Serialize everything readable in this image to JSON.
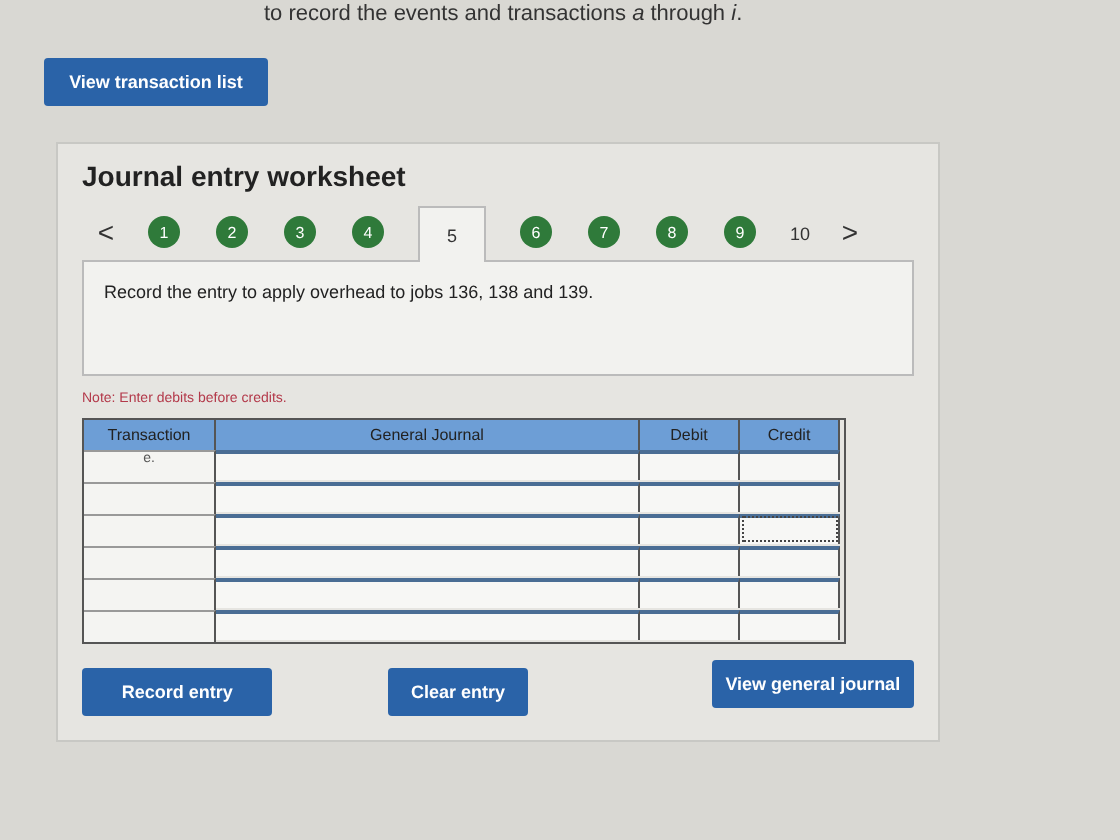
{
  "instruction": "to record the events and transactions *a* through *i*.",
  "transaction_list_button": "View transaction list",
  "worksheet": {
    "title": "Journal entry worksheet",
    "prev": "<",
    "next": ">",
    "steps": [
      {
        "label": "1",
        "selected": false,
        "completed": true
      },
      {
        "label": "2",
        "selected": false,
        "completed": true
      },
      {
        "label": "3",
        "selected": false,
        "completed": true
      },
      {
        "label": "4",
        "selected": false,
        "completed": true
      },
      {
        "label": "5",
        "selected": true
      },
      {
        "label": "6",
        "selected": false,
        "completed": true
      },
      {
        "label": "7",
        "selected": false,
        "completed": true
      },
      {
        "label": "8",
        "selected": false,
        "completed": true
      },
      {
        "label": "9",
        "selected": false,
        "completed": true
      },
      {
        "label": "10",
        "selected": false,
        "completed": false
      }
    ],
    "prompt": "Record the entry to apply overhead to jobs 136, 138 and 139.",
    "note": "Note: Enter debits before credits.",
    "columns": [
      "Transaction",
      "General Journal",
      "Debit",
      "Credit"
    ],
    "rows": [
      {
        "transaction": "e.",
        "credit_focused": false
      },
      {
        "credit_focused": false
      },
      {
        "credit_focused": true
      },
      {
        "credit_focused": false
      },
      {
        "credit_focused": false
      },
      {
        "credit_focused": false
      }
    ],
    "buttons": [
      "Record entry",
      "Clear entry",
      "View general journal"
    ]
  }
}
